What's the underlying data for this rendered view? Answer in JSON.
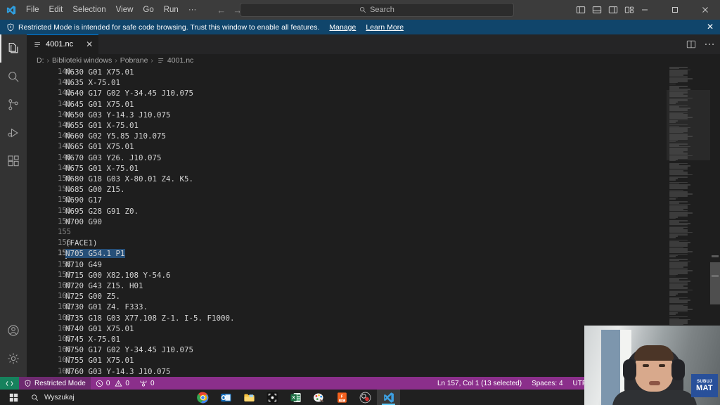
{
  "titlebar": {
    "app_icon": "vscode-logo",
    "menu": [
      "File",
      "Edit",
      "Selection",
      "View",
      "Go",
      "Run",
      "···"
    ],
    "nav_back": "←",
    "nav_forward": "→",
    "search_placeholder": "Search",
    "search_value": "",
    "layout_icons": [
      "panel-left-icon",
      "panel-bottom-icon",
      "panel-right-icon",
      "customize-layout-icon"
    ],
    "window_controls": {
      "minimize": "─",
      "maximize": "□",
      "close": "✕"
    }
  },
  "banner": {
    "icon": "shield-icon",
    "text": "Restricted Mode is intended for safe code browsing. Trust this window to enable all features.",
    "links": [
      "Manage",
      "Learn More"
    ],
    "close": "✕",
    "bg": "#10456b"
  },
  "activitybar": {
    "items": [
      {
        "name": "explorer",
        "icon": "files-icon",
        "active": true
      },
      {
        "name": "search",
        "icon": "search-icon",
        "active": false
      },
      {
        "name": "source-control",
        "icon": "source-control-icon",
        "active": false
      },
      {
        "name": "run-and-debug",
        "icon": "run-debug-icon",
        "active": false
      },
      {
        "name": "extensions",
        "icon": "extensions-icon",
        "active": false
      }
    ],
    "bottom": [
      {
        "name": "accounts",
        "icon": "account-icon"
      },
      {
        "name": "manage",
        "icon": "gear-icon"
      }
    ]
  },
  "tabs": [
    {
      "label": "4001.nc",
      "icon": "file-icon",
      "close": "✕",
      "active": true
    }
  ],
  "tabbar_actions": [
    "split-editor-icon",
    "more-actions-icon"
  ],
  "breadcrumb": [
    "D:",
    "Biblioteki windows",
    "Pobrane",
    "4001.nc"
  ],
  "editor": {
    "first_line_number": 140,
    "cursor_line": 157,
    "selection": {
      "line": 157,
      "start": 0,
      "end": 13
    },
    "lines": [
      {
        "n": 140,
        "text": "N630 G01 X75.01"
      },
      {
        "n": 141,
        "text": "N635 X-75.01"
      },
      {
        "n": 142,
        "text": "N640 G17 G02 Y-34.45 J10.075"
      },
      {
        "n": 143,
        "text": "N645 G01 X75.01"
      },
      {
        "n": 144,
        "text": "N650 G03 Y-14.3 J10.075"
      },
      {
        "n": 145,
        "text": "N655 G01 X-75.01"
      },
      {
        "n": 146,
        "text": "N660 G02 Y5.85 J10.075"
      },
      {
        "n": 147,
        "text": "N665 G01 X75.01"
      },
      {
        "n": 148,
        "text": "N670 G03 Y26. J10.075"
      },
      {
        "n": 149,
        "text": "N675 G01 X-75.01"
      },
      {
        "n": 150,
        "text": "N680 G18 G03 X-80.01 Z4. K5."
      },
      {
        "n": 151,
        "text": "N685 G00 Z15."
      },
      {
        "n": 152,
        "text": "N690 G17"
      },
      {
        "n": 153,
        "text": "N695 G28 G91 Z0."
      },
      {
        "n": 154,
        "text": "N700 G90"
      },
      {
        "n": 155,
        "text": ""
      },
      {
        "n": 156,
        "text": "(FACE1)"
      },
      {
        "n": 157,
        "text": "N705 G54.1 P1"
      },
      {
        "n": 158,
        "text": "N710 G49"
      },
      {
        "n": 159,
        "text": "N715 G00 X82.108 Y-54.6"
      },
      {
        "n": 160,
        "text": "N720 G43 Z15. H01"
      },
      {
        "n": 161,
        "text": "N725 G00 Z5."
      },
      {
        "n": 162,
        "text": "N730 G01 Z4. F333."
      },
      {
        "n": 163,
        "text": "N735 G18 G03 X77.108 Z-1. I-5. F1000."
      },
      {
        "n": 164,
        "text": "N740 G01 X75.01"
      },
      {
        "n": 165,
        "text": "N745 X-75.01"
      },
      {
        "n": 166,
        "text": "N750 G17 G02 Y-34.45 J10.075"
      },
      {
        "n": 167,
        "text": "N755 G01 X75.01"
      },
      {
        "n": 168,
        "text": "N760 G03 Y-14.3 J10.075"
      }
    ]
  },
  "statusbar": {
    "remote_icon": "remote-window-icon",
    "trust_icon": "shield-icon",
    "trust_label": "Restricted Mode",
    "errors_icon": "error-icon",
    "errors": "0",
    "warnings_icon": "warning-icon",
    "warnings": "0",
    "ports_icon": "ports-icon",
    "ports": "0",
    "cursor_position": "Ln 157, Col 1 (13 selected)",
    "indentation": "Spaces: 4",
    "encoding": "UTF",
    "bg": "#8b2f8b"
  },
  "taskbar": {
    "start_icon": "windows-start-icon",
    "search_icon": "search-icon",
    "search_placeholder": "Wyszukaj",
    "icons": [
      {
        "name": "chrome-icon"
      },
      {
        "name": "outlook-icon"
      },
      {
        "name": "file-explorer-icon"
      },
      {
        "name": "snipping-tool-icon"
      },
      {
        "name": "excel-icon"
      },
      {
        "name": "paint-icon"
      },
      {
        "name": "foxit-pdf-icon"
      },
      {
        "name": "obs-icon"
      },
      {
        "name": "vscode-icon",
        "active": true
      }
    ]
  },
  "webcam": {
    "logo_top": "SUBUJ",
    "logo_bottom": "MAT"
  }
}
